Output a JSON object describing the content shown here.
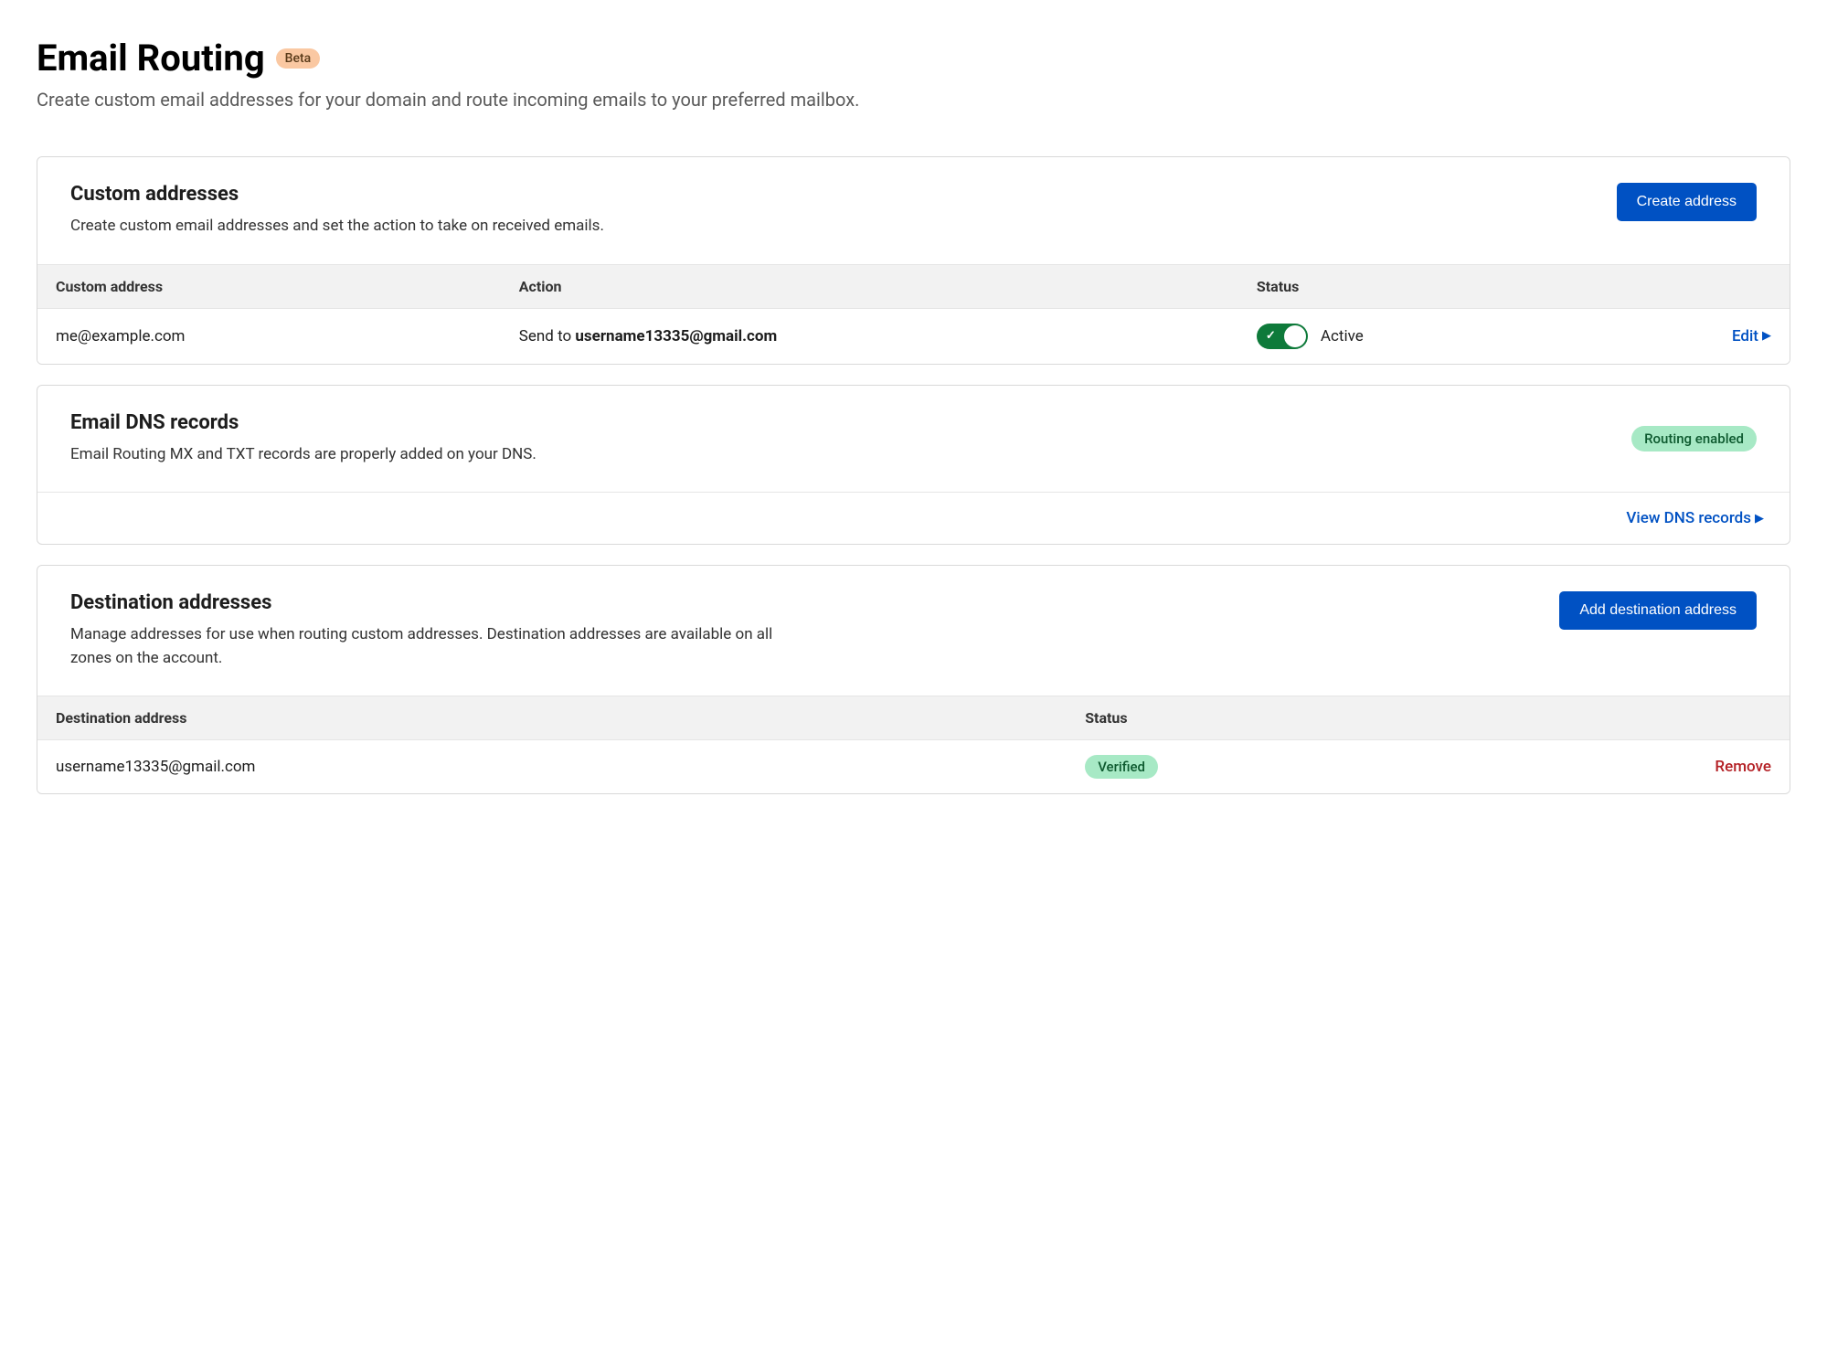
{
  "header": {
    "title": "Email Routing",
    "badge": "Beta",
    "subtitle": "Create custom email addresses for your domain and route incoming emails to your preferred mailbox."
  },
  "custom": {
    "title": "Custom addresses",
    "desc": "Create custom email addresses and set the action to take on received emails.",
    "create_btn": "Create address",
    "columns": {
      "address": "Custom address",
      "action": "Action",
      "status": "Status"
    },
    "rows": [
      {
        "address": "me@example.com",
        "action_prefix": "Send to ",
        "action_email": "username13335@gmail.com",
        "enabled": true,
        "status_label": "Active",
        "edit_label": "Edit"
      }
    ]
  },
  "dns": {
    "title": "Email DNS records",
    "desc": "Email Routing MX and TXT records are properly added on your DNS.",
    "status_badge": "Routing enabled",
    "view_link": "View DNS records"
  },
  "dest": {
    "title": "Destination addresses",
    "desc": "Manage addresses for use when routing custom addresses. Destination addresses are available on all zones on the account.",
    "add_btn": "Add destination address",
    "columns": {
      "address": "Destination address",
      "status": "Status"
    },
    "rows": [
      {
        "address": "username13335@gmail.com",
        "status_badge": "Verified",
        "remove_label": "Remove"
      }
    ]
  }
}
